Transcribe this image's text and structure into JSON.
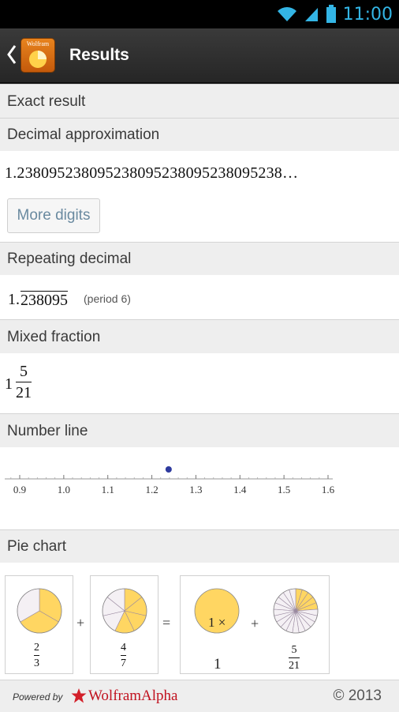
{
  "status": {
    "time": "11:00"
  },
  "header": {
    "title": "Results",
    "logo_text": "Wolfram"
  },
  "pods": {
    "exact": {
      "title": "Exact result"
    },
    "decimal": {
      "title": "Decimal approximation",
      "value": "1.238095238095238095238095238095238…",
      "more_button": "More digits"
    },
    "repeating": {
      "title": "Repeating decimal",
      "integer_part": "1.",
      "repeating_digits": "238095",
      "note": "(period 6)"
    },
    "mixed": {
      "title": "Mixed fraction",
      "integer": "1",
      "numerator": "5",
      "denominator": "21"
    },
    "numberline": {
      "title": "Number line",
      "ticks": [
        "0.9",
        "1.0",
        "1.1",
        "1.2",
        "1.3",
        "1.4",
        "1.5",
        "1.6"
      ],
      "value": 1.238095,
      "min": 0.9,
      "max": 1.6,
      "point_color": "#2e3a9e"
    },
    "pie": {
      "title": "Pie chart",
      "fill_color": "#ffd662",
      "empty_color": "#f4f0f4",
      "plus": "+",
      "equals": "=",
      "times": "1 ×",
      "one": "1",
      "f1": {
        "num": "2",
        "den": "3",
        "filled": 2,
        "total": 3
      },
      "f2": {
        "num": "4",
        "den": "7",
        "filled": 4,
        "total": 7
      },
      "f3": {
        "num": "5",
        "den": "21",
        "filled": 5,
        "total": 21
      }
    }
  },
  "footer": {
    "powered": "Powered by",
    "brand": "WolframAlpha",
    "copyright": "© 2013"
  }
}
